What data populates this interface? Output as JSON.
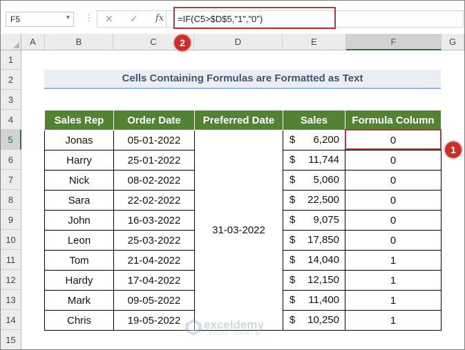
{
  "formula_bar": {
    "name_box": "F5",
    "name_box_arrow": "▾",
    "cancel_glyph": "✕",
    "enter_glyph": "✓",
    "fx_label": "fx",
    "formula": "=IF(C5>$D$5,\"1\",\"0\")"
  },
  "columns": [
    "A",
    "B",
    "C",
    "D",
    "E",
    "F",
    "G"
  ],
  "selected_column": "F",
  "rows": [
    "1",
    "2",
    "3",
    "4",
    "5",
    "6",
    "7",
    "8",
    "9",
    "10",
    "11",
    "12",
    "13",
    "14",
    "15"
  ],
  "selected_row": "5",
  "title": "Cells Containing Formulas are Formatted as Text",
  "table": {
    "headers": [
      "Sales Rep",
      "Order Date",
      "Preferred Date",
      "Sales",
      "Formula Column"
    ],
    "preferred_date": "31-03-2022",
    "currency_symbol": "$",
    "rows": [
      {
        "rep": "Jonas",
        "date": "05-01-2022",
        "sales": "6,200",
        "formula": "0"
      },
      {
        "rep": "Harry",
        "date": "25-01-2022",
        "sales": "11,744",
        "formula": "0"
      },
      {
        "rep": "Nick",
        "date": "08-02-2022",
        "sales": "5,060",
        "formula": "0"
      },
      {
        "rep": "Sara",
        "date": "22-02-2022",
        "sales": "22,500",
        "formula": "0"
      },
      {
        "rep": "John",
        "date": "16-03-2022",
        "sales": "9,075",
        "formula": "0"
      },
      {
        "rep": "Leon",
        "date": "25-03-2022",
        "sales": "17,850",
        "formula": "0"
      },
      {
        "rep": "Tom",
        "date": "21-04-2022",
        "sales": "14,040",
        "formula": "1"
      },
      {
        "rep": "Hardy",
        "date": "17-04-2022",
        "sales": "12,150",
        "formula": "1"
      },
      {
        "rep": "Mark",
        "date": "09-05-2022",
        "sales": "11,400",
        "formula": "1"
      },
      {
        "rep": "Chris",
        "date": "19-05-2022",
        "sales": "10,250",
        "formula": "1"
      }
    ]
  },
  "annotations": {
    "badge_1": "1",
    "badge_2": "2"
  },
  "colors": {
    "header_green": "#548235",
    "highlight_red": "#b03a3a",
    "badge_red": "#c8312b",
    "title_band": "#e9edf4"
  },
  "watermark": {
    "name": "exceldemy",
    "tagline": "EXCEL · DATA · BI"
  }
}
